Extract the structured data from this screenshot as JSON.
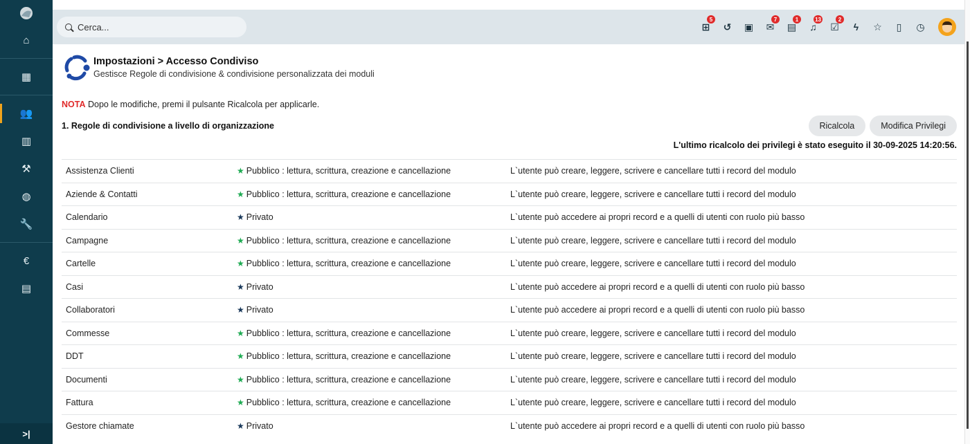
{
  "sidebar": {
    "items": [
      {
        "name": "home-icon",
        "glyph": "⌂"
      },
      {
        "name": "grid-icon",
        "glyph": "▦"
      },
      {
        "name": "users-icon",
        "glyph": "👥",
        "active": true
      },
      {
        "name": "building-icon",
        "glyph": "▥"
      },
      {
        "name": "gavel-icon",
        "glyph": "⚒"
      },
      {
        "name": "globe-icon",
        "glyph": "◍"
      },
      {
        "name": "wrench-icon",
        "glyph": "🔧"
      },
      {
        "name": "euro-icon",
        "glyph": "€"
      },
      {
        "name": "calculator-icon",
        "glyph": "▤"
      }
    ],
    "collapse_label": ">|"
  },
  "search": {
    "placeholder": "Cerca..."
  },
  "topbar_icons": [
    {
      "name": "sitemap-icon",
      "glyph": "⊞",
      "badge": "5"
    },
    {
      "name": "history-icon",
      "glyph": "↺",
      "badge": ""
    },
    {
      "name": "calendar-icon",
      "glyph": "▣",
      "badge": ""
    },
    {
      "name": "mail-icon",
      "glyph": "✉",
      "badge": "7"
    },
    {
      "name": "chat-icon",
      "glyph": "▤",
      "badge": "1"
    },
    {
      "name": "bell-icon",
      "glyph": "♫",
      "badge": "13"
    },
    {
      "name": "tasks-icon",
      "glyph": "☑",
      "badge": "2"
    },
    {
      "name": "bolt-icon",
      "glyph": "ϟ",
      "badge": ""
    },
    {
      "name": "star-icon",
      "glyph": "☆",
      "badge": ""
    },
    {
      "name": "document-icon",
      "glyph": "▯",
      "badge": ""
    },
    {
      "name": "stopwatch-icon",
      "glyph": "◷",
      "badge": ""
    }
  ],
  "header": {
    "title": "Impostazioni > Accesso Condiviso",
    "subtitle": "Gestisce Regole di condivisione & condivisione personalizzata dei moduli"
  },
  "note": {
    "label": "NOTA",
    "text": " Dopo le modifiche, premi il pulsante Ricalcola per applicarle."
  },
  "section": {
    "title": "1. Regole di condivisione a livello di organizzazione",
    "recalc_button": "Ricalcola",
    "edit_button": "Modifica Privilegi",
    "recalc_info": "L'ultimo ricalcolo dei privilegi è stato eseguito il 30-09-2025 14:20:56."
  },
  "colors": {
    "public_star": "#1eaa52",
    "private_star": "#19385a",
    "note": "#e02b2b",
    "sidebar": "#0f3c4c"
  },
  "rules": [
    {
      "module": "Assistenza Clienti",
      "type": "public",
      "access": "Pubblico : lettura, scrittura, creazione e cancellazione",
      "description": "L`utente può creare, leggere, scrivere e cancellare tutti i record del modulo"
    },
    {
      "module": "Aziende & Contatti",
      "type": "public",
      "access": "Pubblico : lettura, scrittura, creazione e cancellazione",
      "description": "L`utente può creare, leggere, scrivere e cancellare tutti i record del modulo"
    },
    {
      "module": "Calendario",
      "type": "private",
      "access": "Privato",
      "description": "L`utente può accedere ai propri record e a quelli di utenti con ruolo più basso"
    },
    {
      "module": "Campagne",
      "type": "public",
      "access": "Pubblico : lettura, scrittura, creazione e cancellazione",
      "description": "L`utente può creare, leggere, scrivere e cancellare tutti i record del modulo"
    },
    {
      "module": "Cartelle",
      "type": "public",
      "access": "Pubblico : lettura, scrittura, creazione e cancellazione",
      "description": "L`utente può creare, leggere, scrivere e cancellare tutti i record del modulo"
    },
    {
      "module": "Casi",
      "type": "private",
      "access": "Privato",
      "description": "L`utente può accedere ai propri record e a quelli di utenti con ruolo più basso"
    },
    {
      "module": "Collaboratori",
      "type": "private",
      "access": "Privato",
      "description": "L`utente può accedere ai propri record e a quelli di utenti con ruolo più basso"
    },
    {
      "module": "Commesse",
      "type": "public",
      "access": "Pubblico : lettura, scrittura, creazione e cancellazione",
      "description": "L`utente può creare, leggere, scrivere e cancellare tutti i record del modulo"
    },
    {
      "module": "DDT",
      "type": "public",
      "access": "Pubblico : lettura, scrittura, creazione e cancellazione",
      "description": "L`utente può creare, leggere, scrivere e cancellare tutti i record del modulo"
    },
    {
      "module": "Documenti",
      "type": "public",
      "access": "Pubblico : lettura, scrittura, creazione e cancellazione",
      "description": "L`utente può creare, leggere, scrivere e cancellare tutti i record del modulo"
    },
    {
      "module": "Fattura",
      "type": "public",
      "access": "Pubblico : lettura, scrittura, creazione e cancellazione",
      "description": "L`utente può creare, leggere, scrivere e cancellare tutti i record del modulo"
    },
    {
      "module": "Gestore chiamate",
      "type": "private",
      "access": "Privato",
      "description": "L`utente può accedere ai propri record e a quelli di utenti con ruolo più basso"
    }
  ]
}
